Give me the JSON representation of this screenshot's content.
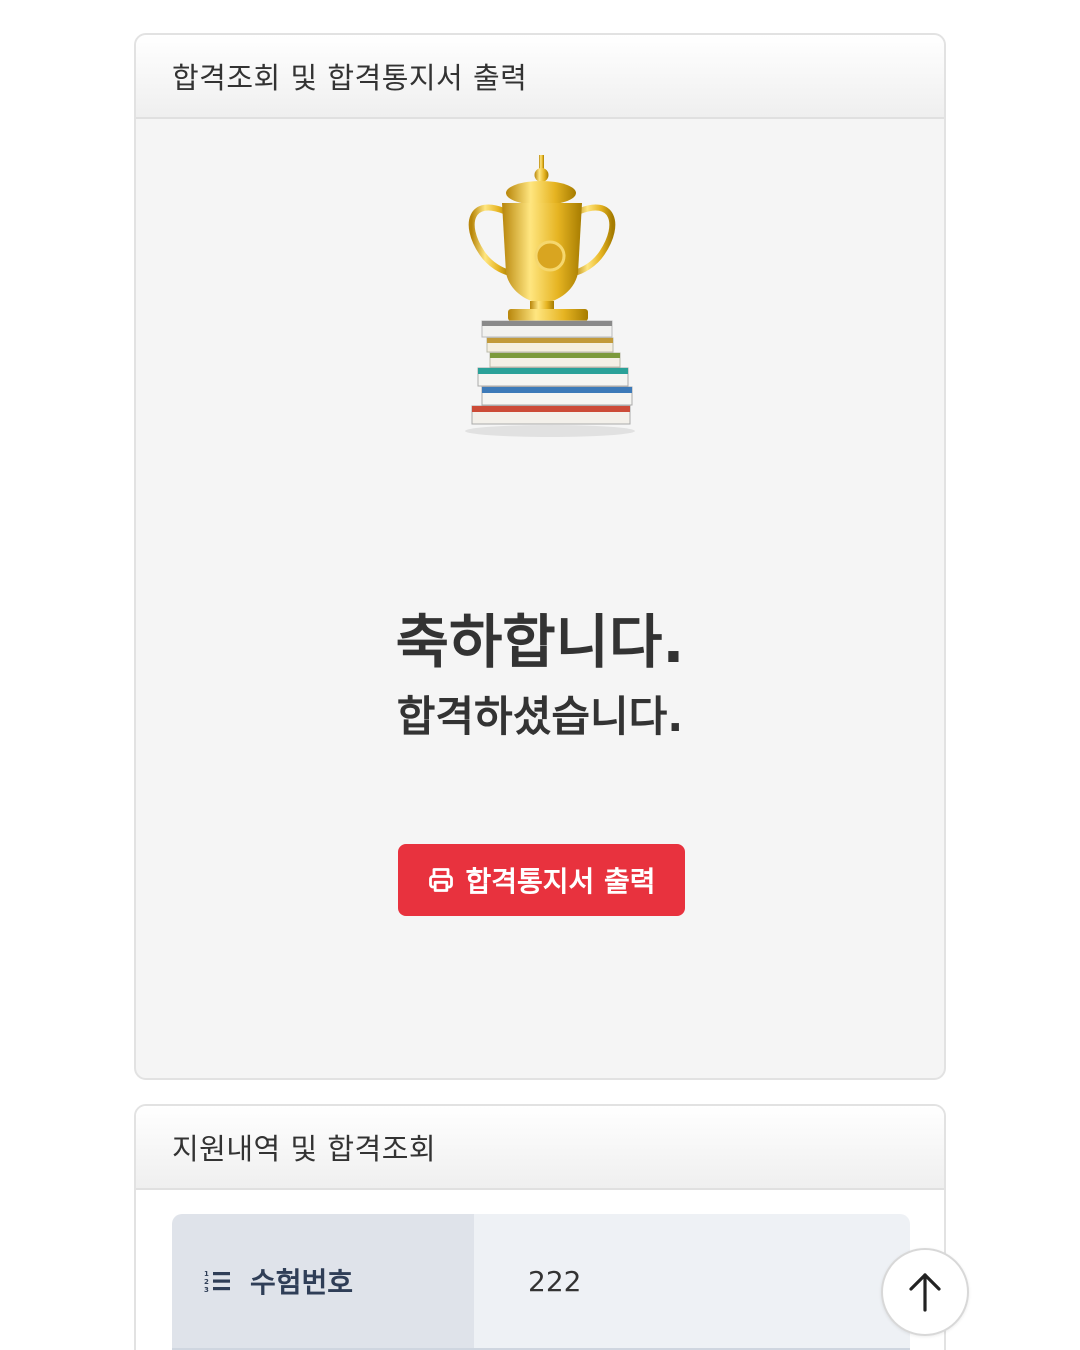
{
  "result_card": {
    "header": "합격조회 및 합격통지서 출력",
    "message_main": "축하합니다.",
    "message_sub": "합격하셨습니다.",
    "print_button": {
      "icon": "print-icon",
      "label": "합격통지서 출력"
    },
    "image": "trophy-on-books"
  },
  "application_card": {
    "header": "지원내역 및 합격조회",
    "rows": [
      {
        "icon": "ordered-list-icon",
        "label": "수험번호",
        "value": "222"
      }
    ]
  },
  "scroll_top": {
    "icon": "arrow-up-icon"
  },
  "colors": {
    "accent": "#e8323e",
    "card_bg": "#f5f5f5",
    "label_bg": "#dfe3ea",
    "label_text": "#2f3e57"
  }
}
